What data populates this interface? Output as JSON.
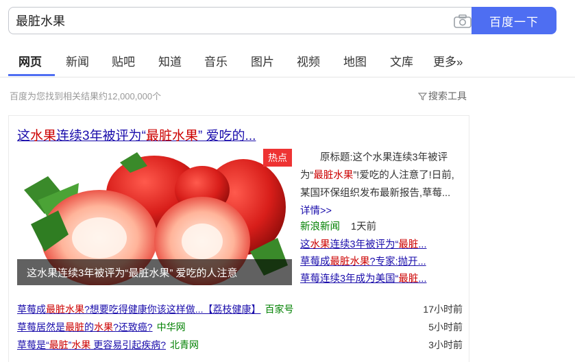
{
  "search": {
    "query": "最脏水果",
    "button": "百度一下"
  },
  "tabs": [
    {
      "label": "网页",
      "active": true
    },
    {
      "label": "新闻"
    },
    {
      "label": "贴吧"
    },
    {
      "label": "知道"
    },
    {
      "label": "音乐"
    },
    {
      "label": "图片"
    },
    {
      "label": "视频"
    },
    {
      "label": "地图"
    },
    {
      "label": "文库"
    },
    {
      "label": "更多»"
    }
  ],
  "result_count": "百度为您找到相关结果约12,000,000个",
  "search_tools": "搜索工具",
  "card": {
    "title_parts": [
      "这",
      "水果",
      "连续3年被评为“",
      "最脏水果",
      "” 爱吃的..."
    ],
    "hot_badge": "热点",
    "image_caption": "这水果连续3年被评为“最脏水果” 爱吃的人注意",
    "abstract_parts": [
      "原标题:这个水果连续3年被评为“",
      "最脏水果",
      "”!爱吃的人注意了!日前,某国环保组织发布最新报告,草莓... "
    ],
    "detail_link": "详情>>",
    "source": "新浪新闻",
    "time": "1天前",
    "related": [
      {
        "parts": [
          "这",
          "水果",
          "连续3年被评为“",
          "最脏",
          "..."
        ]
      },
      {
        "parts": [
          "草莓成",
          "最脏水果",
          "?专家:抛开..."
        ]
      },
      {
        "parts": [
          "草莓连续3年成为美国“",
          "最脏",
          "..."
        ]
      }
    ],
    "news": [
      {
        "parts": [
          "草莓成",
          "最脏水果",
          "?想要吃得健康你该这样做...【荔枝健康】"
        ],
        "source": "百家号",
        "time": "17小时前"
      },
      {
        "parts": [
          "草莓居然是",
          "最脏",
          "的",
          "水果",
          "?还致癌?"
        ],
        "source": "中华网",
        "time": "5小时前"
      },
      {
        "parts": [
          "草莓是“",
          "最脏",
          "”",
          "水果",
          " 更容易引起疾病?"
        ],
        "source": "北青网",
        "time": "3小时前"
      }
    ]
  },
  "colors": {
    "accent": "#4e6ef2",
    "link": "#1a0dab",
    "highlight": "#c00",
    "source": "#008000",
    "badge": "#e33"
  },
  "icons": [
    "camera-icon",
    "filter-icon"
  ]
}
